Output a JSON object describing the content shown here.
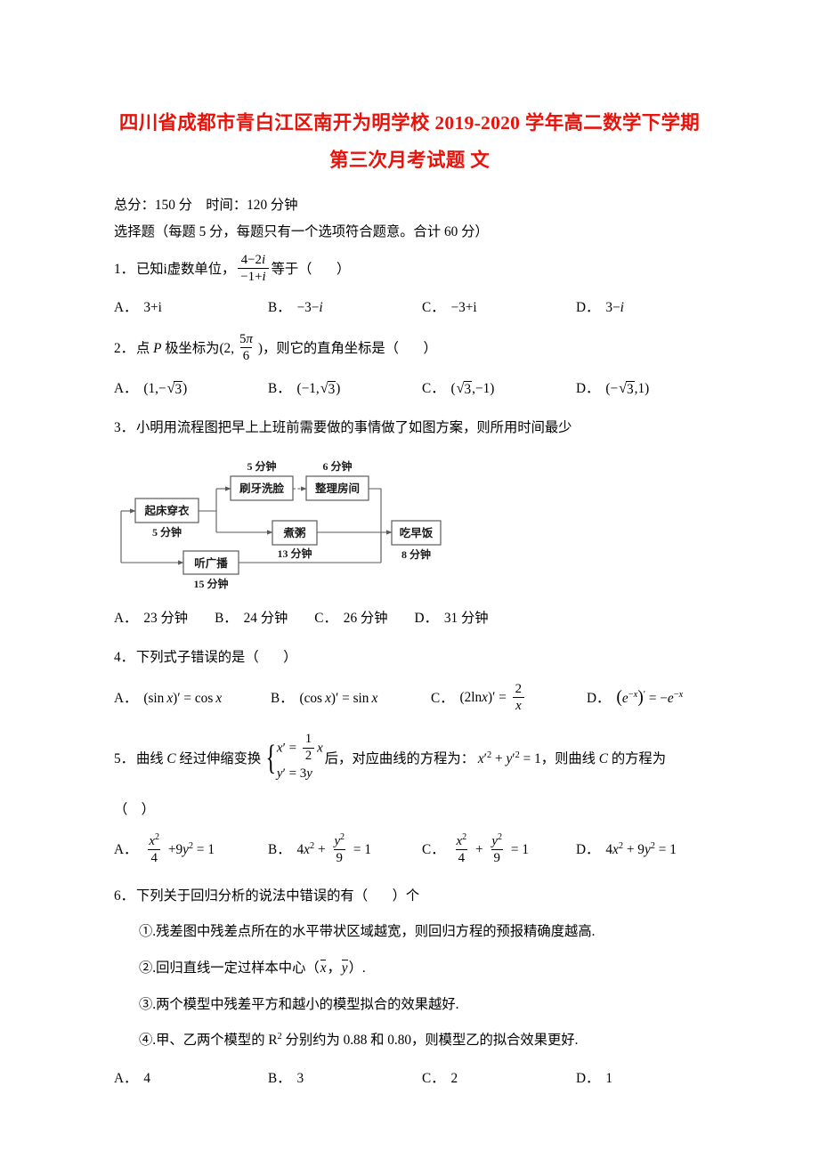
{
  "document": {
    "title_line1": "四川省成都市青白江区南开为明学校 2019-2020 学年高二数学下学期",
    "title_line2": "第三次月考试题 文",
    "title_color": "#e8140c",
    "meta_score": "总分：150 分　时间：120 分钟",
    "meta_instruction": "选择题（每题 5 分，每题只有一个选项符合题意。合计 60 分）"
  },
  "questions": [
    {
      "number": "1．",
      "stem_before": "已知i虚数单位，",
      "frac_num": "4－2i",
      "frac_den": "－1+i",
      "stem_after": "等于（",
      "stem_close": "）",
      "options": [
        {
          "label": "A．",
          "text": "3+i"
        },
        {
          "label": "B．",
          "text": "－3－i"
        },
        {
          "label": "C．",
          "text": "－3+i"
        },
        {
          "label": "D．",
          "text": "3－i"
        }
      ]
    },
    {
      "number": "2．",
      "stem_before": "点 P 极坐标为(2,",
      "frac_num": "5π",
      "frac_den": "6",
      "stem_after": ")，则它的直角坐标是（",
      "stem_close": "）",
      "options": [
        {
          "label": "A．",
          "text": "(1,－√3)"
        },
        {
          "label": "B．",
          "text": "(－1,√3)"
        },
        {
          "label": "C．",
          "text": "(√3,－1)"
        },
        {
          "label": "D．",
          "text": "(－√3,1)"
        }
      ]
    },
    {
      "number": "3．",
      "stem": "小明用流程图把早上上班前需要做的事情做了如图方案，则所用时间最少",
      "options": [
        {
          "label": "A．",
          "text": "23 分钟"
        },
        {
          "label": "B．",
          "text": "24 分钟"
        },
        {
          "label": "C．",
          "text": "26 分钟"
        },
        {
          "label": "D．",
          "text": "31 分钟"
        }
      ]
    },
    {
      "number": "4．",
      "stem": "下列式子错误的是（",
      "stem_close": "）",
      "options": [
        {
          "label": "A．",
          "text": "(sin x)′ = cos x"
        },
        {
          "label": "B．",
          "text": "(cos x)′ = sin x"
        },
        {
          "label": "C．",
          "text": "(2lnx)′ = 2/x"
        },
        {
          "label": "D．",
          "text": "(e^(-x))′ = －e^(-x)"
        }
      ]
    },
    {
      "number": "5．",
      "stem_before": "曲线 C 经过伸缩变换",
      "sys_row1_lhs": "x′ =",
      "sys_row1_num": "1",
      "sys_row1_den": "2",
      "sys_row1_var": "x",
      "sys_row2": "y′ = 3y",
      "stem_mid": "后，对应曲线的方程为：",
      "equation": "x′² + y′² = 1",
      "stem_after": "，则曲线 C 的方程为",
      "stem_paren": "（　）",
      "options": [
        {
          "label": "A．",
          "text": "x²/4 + 9y² = 1"
        },
        {
          "label": "B．",
          "text": "4x² + y²/9 = 1"
        },
        {
          "label": "C．",
          "text": "x²/4 + y²/9 = 1"
        },
        {
          "label": "D．",
          "text": "4x² + 9y² = 1"
        }
      ]
    },
    {
      "number": "6．",
      "stem": "下列关于回归分析的说法中错误的有（",
      "stem_close": "）个",
      "sub_items": [
        "①.残差图中残差点所在的水平带状区域越宽，则回归方程的预报精确度越高.",
        "②.回归直线一定过样本中心（x̄，ȳ）.",
        "③.两个模型中残差平方和越小的模型拟合的效果越好.",
        "④.甲、乙两个模型的 R² 分别约为 0.88 和 0.80，则模型乙的拟合效果更好."
      ],
      "options": [
        {
          "label": "A．",
          "text": "4"
        },
        {
          "label": "B．",
          "text": "3"
        },
        {
          "label": "C．",
          "text": "2"
        },
        {
          "label": "D．",
          "text": "1"
        }
      ]
    }
  ],
  "flowchart": {
    "nodes": [
      {
        "id": "getup",
        "label": "起床穿衣",
        "duration": "5 分钟",
        "duration_pos": "below"
      },
      {
        "id": "brush",
        "label": "刷牙洗脸",
        "duration": "5 分钟",
        "duration_pos": "above"
      },
      {
        "id": "tidy",
        "label": "整理房间",
        "duration": "6 分钟",
        "duration_pos": "above"
      },
      {
        "id": "congee",
        "label": "煮粥",
        "duration": "13 分钟",
        "duration_pos": "below"
      },
      {
        "id": "radio",
        "label": "听广播",
        "duration": "15 分钟",
        "duration_pos": "below"
      },
      {
        "id": "eat",
        "label": "吃早饭",
        "duration": "8 分钟",
        "duration_pos": "below"
      }
    ],
    "stroke_color": "#5a5a5a"
  }
}
